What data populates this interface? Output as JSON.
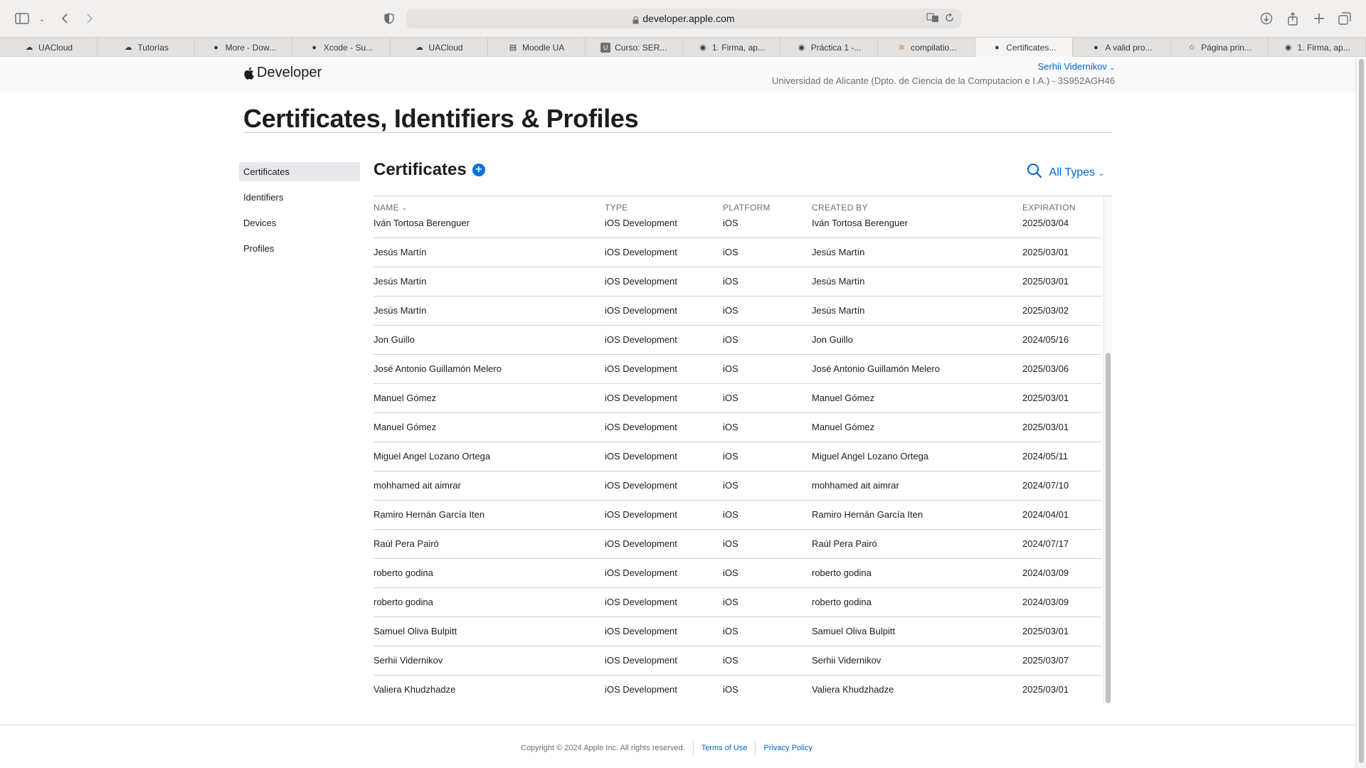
{
  "browser": {
    "url": "developer.apple.com",
    "tabs": [
      {
        "label": "UACloud",
        "icon": "cloud-icon"
      },
      {
        "label": "Tutorías",
        "icon": "cloud-icon"
      },
      {
        "label": "More - Dow...",
        "icon": "apple-icon"
      },
      {
        "label": "Xcode - Su...",
        "icon": "apple-icon"
      },
      {
        "label": "UACloud",
        "icon": "cloud-icon"
      },
      {
        "label": "Moodle UA",
        "icon": "moodle-icon"
      },
      {
        "label": "Curso: SER...",
        "icon": "u-icon"
      },
      {
        "label": "1. Firma, ap...",
        "icon": "record-icon"
      },
      {
        "label": "Práctica 1 -...",
        "icon": "record-icon"
      },
      {
        "label": "compilatio...",
        "icon": "stack-icon"
      },
      {
        "label": "Certificates...",
        "icon": "apple-icon",
        "active": true
      },
      {
        "label": "A valid pro...",
        "icon": "apple-icon"
      },
      {
        "label": "Página prin...",
        "icon": "star-icon"
      },
      {
        "label": "1. Firma, ap...",
        "icon": "record-icon"
      }
    ]
  },
  "header": {
    "brand": "Developer",
    "account_name": "Serhii Vidernikov",
    "team": "Universidad de Alicante (Dpto. de Ciencia de la Computacion e I.A.) - 3S952AGH46"
  },
  "page_title": "Certificates, Identifiers & Profiles",
  "sidenav": [
    "Certificates",
    "Identifiers",
    "Devices",
    "Profiles"
  ],
  "section": {
    "title": "Certificates",
    "filter_label": "All Types"
  },
  "table": {
    "columns": [
      "NAME",
      "TYPE",
      "PLATFORM",
      "CREATED BY",
      "EXPIRATION"
    ],
    "rows": [
      [
        "Iván Tortosa Berenguer",
        "iOS Development",
        "iOS",
        "Iván Tortosa Berenguer",
        "2025/03/04"
      ],
      [
        "Jesús Martín",
        "iOS Development",
        "iOS",
        "Jesús Martín",
        "2025/03/01"
      ],
      [
        "Jesús Martín",
        "iOS Development",
        "iOS",
        "Jesús Martín",
        "2025/03/01"
      ],
      [
        "Jesús Martín",
        "iOS Development",
        "iOS",
        "Jesús Martín",
        "2025/03/02"
      ],
      [
        "Jon Guillo",
        "iOS Development",
        "iOS",
        "Jon Guillo",
        "2024/05/16"
      ],
      [
        "José Antonio Guillamón Melero",
        "iOS Development",
        "iOS",
        "José Antonio Guillamón Melero",
        "2025/03/06"
      ],
      [
        "Manuel Gómez",
        "iOS Development",
        "iOS",
        "Manuel Gómez",
        "2025/03/01"
      ],
      [
        "Manuel Gómez",
        "iOS Development",
        "iOS",
        "Manuel Gómez",
        "2025/03/01"
      ],
      [
        "Miguel Angel Lozano Ortega",
        "iOS Development",
        "iOS",
        "Miguel Angel Lozano Ortega",
        "2024/05/11"
      ],
      [
        "mohhamed ait aimrar",
        "iOS Development",
        "iOS",
        "mohhamed ait aimrar",
        "2024/07/10"
      ],
      [
        "Ramiro Hernán García Iten",
        "iOS Development",
        "iOS",
        "Ramiro Hernán García Iten",
        "2024/04/01"
      ],
      [
        "Raúl Pera Pairó",
        "iOS Development",
        "iOS",
        "Raúl Pera Pairó",
        "2024/07/17"
      ],
      [
        "roberto godina",
        "iOS Development",
        "iOS",
        "roberto godina",
        "2024/03/09"
      ],
      [
        "roberto godina",
        "iOS Development",
        "iOS",
        "roberto godina",
        "2024/03/09"
      ],
      [
        "Samuel Oliva Bulpitt",
        "iOS Development",
        "iOS",
        "Samuel Oliva Bulpitt",
        "2025/03/01"
      ],
      [
        "Serhii Vidernikov",
        "iOS Development",
        "iOS",
        "Serhii Vidernikov",
        "2025/03/07"
      ],
      [
        "Valiera Khudzhadze",
        "iOS Development",
        "iOS",
        "Valiera Khudzhadze",
        "2025/03/01"
      ]
    ]
  },
  "footer": {
    "copyright": "Copyright © 2024 Apple Inc. All rights reserved.",
    "terms": "Terms of Use",
    "privacy": "Privacy Policy"
  },
  "colors": {
    "accent": "#0066cc",
    "add_button": "#0071e3"
  }
}
